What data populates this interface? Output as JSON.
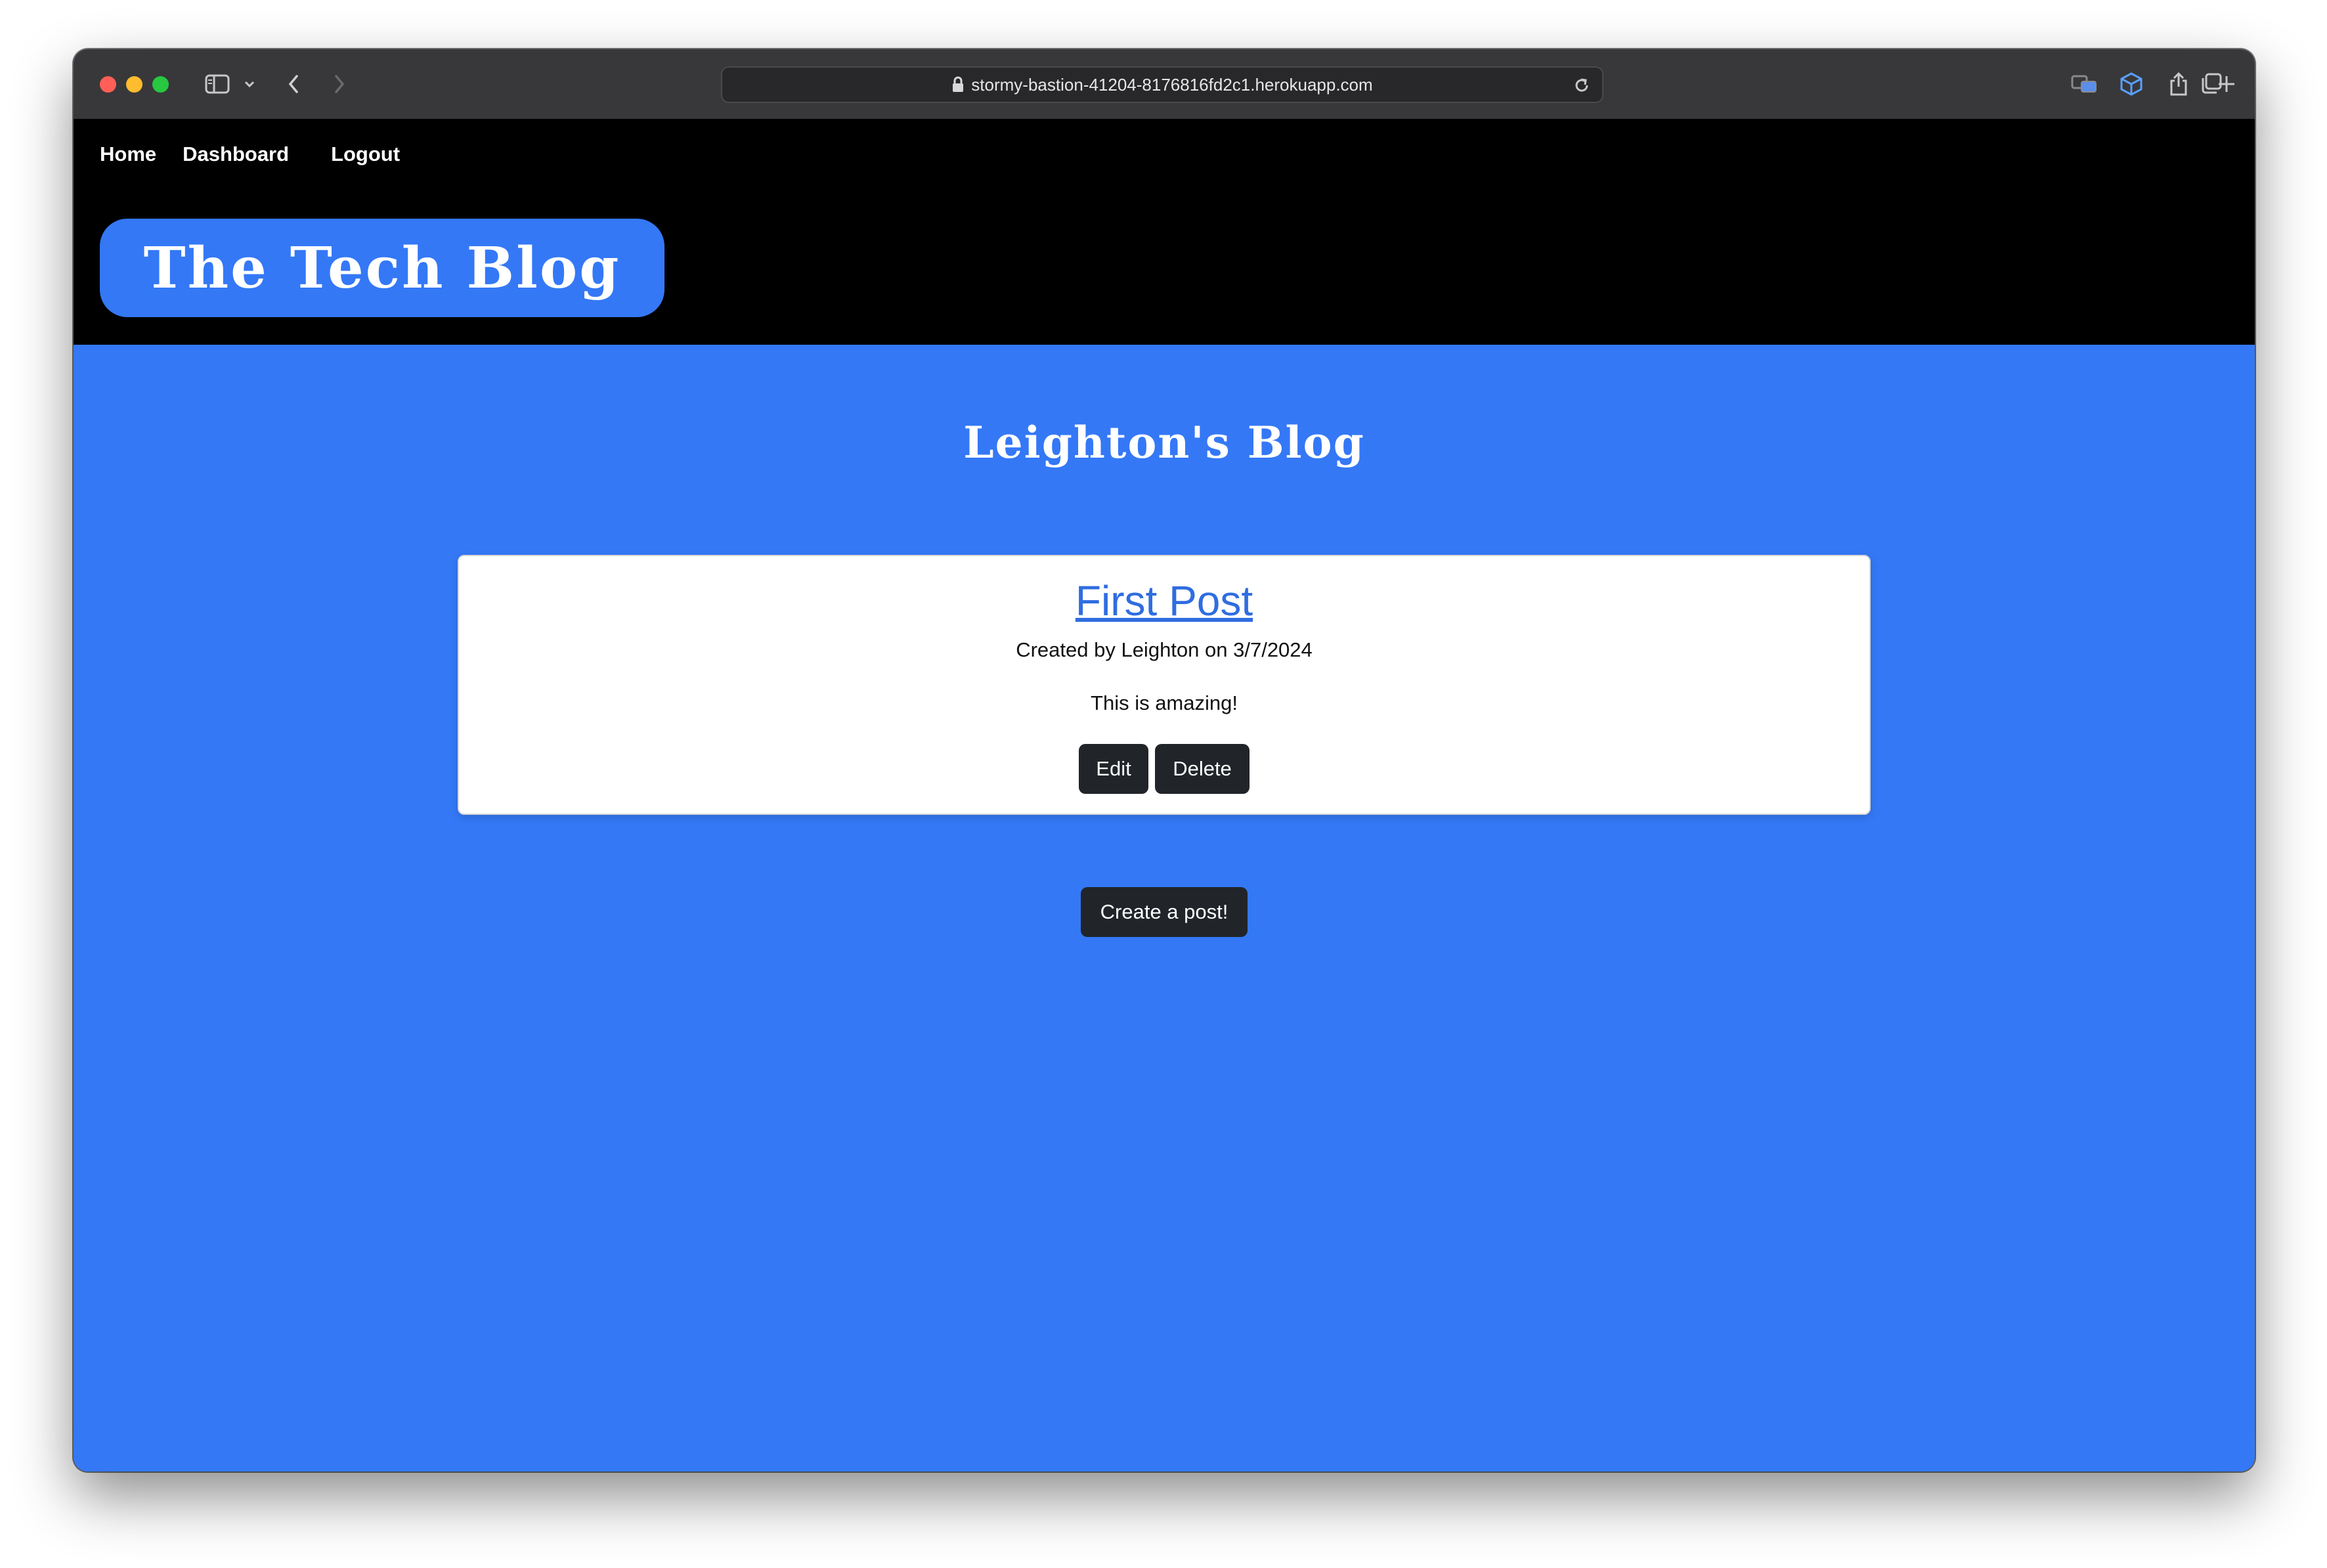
{
  "browser": {
    "url": "stormy-bastion-41204-8176816fd2c1.herokuapp.com",
    "icons": [
      "sidebar-icon",
      "chevron-down-icon",
      "back-icon",
      "forward-icon",
      "lock-icon",
      "reload-icon",
      "translate-icon",
      "extension-icon",
      "share-icon",
      "new-tab-icon",
      "tab-overview-icon"
    ]
  },
  "nav": {
    "home": "Home",
    "dashboard": "Dashboard",
    "logout": "Logout"
  },
  "brand": {
    "title": "The Tech Blog"
  },
  "dashboard": {
    "heading": "Leighton's Blog",
    "posts": [
      {
        "title": "First Post",
        "meta": "Created by Leighton on 3/7/2024",
        "body": "This is amazing!",
        "edit_label": "Edit",
        "delete_label": "Delete"
      }
    ],
    "create_label": "Create a post!"
  },
  "colors": {
    "page_background": "#3478f6",
    "header_background": "#000000",
    "button_background": "#212529",
    "link": "#2f6de0"
  }
}
